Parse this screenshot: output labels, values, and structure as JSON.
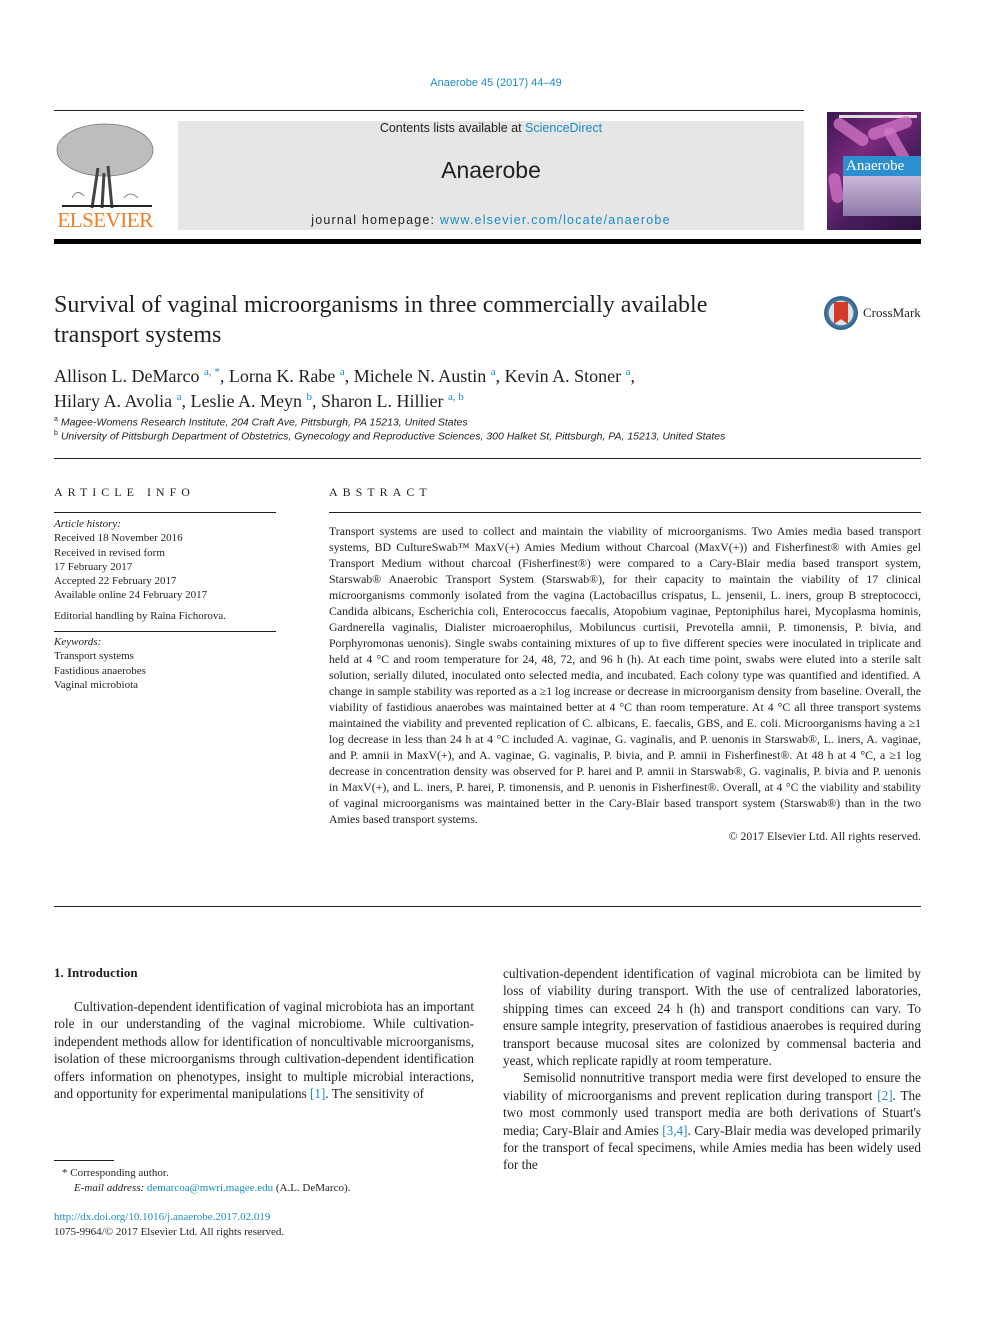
{
  "header": {
    "citation": "Anaerobe 45 (2017) 44–49",
    "contents_prefix": "Contents lists available at ",
    "contents_link": "ScienceDirect",
    "journal_name": "Anaerobe",
    "homepage_prefix": "journal homepage: ",
    "homepage_link": "www.elsevier.com/locate/anaerobe",
    "publisher_logo_text": "ELSEVIER",
    "cover_title": "Anaerobe",
    "crossmark_label": "CrossMark"
  },
  "article": {
    "title": "Survival of vaginal microorganisms in three commercially available transport systems",
    "authors": [
      {
        "name": "Allison L. DeMarco",
        "sup": "a, *"
      },
      {
        "name": "Lorna K. Rabe",
        "sup": "a"
      },
      {
        "name": "Michele N. Austin",
        "sup": "a"
      },
      {
        "name": "Kevin A. Stoner",
        "sup": "a"
      },
      {
        "name": "Hilary A. Avolia",
        "sup": "a"
      },
      {
        "name": "Leslie A. Meyn",
        "sup": "b"
      },
      {
        "name": "Sharon L. Hillier",
        "sup": "a, b"
      }
    ],
    "affiliations": [
      {
        "sup": "a",
        "text": "Magee-Womens Research Institute, 204 Craft Ave, Pittsburgh, PA 15213, United States"
      },
      {
        "sup": "b",
        "text": "University of Pittsburgh Department of Obstetrics, Gynecology and Reproductive Sciences, 300 Halket St, Pittsburgh, PA, 15213, United States"
      }
    ]
  },
  "article_info": {
    "heading": "ARTICLE INFO",
    "history_label": "Article history:",
    "history": [
      "Received 18 November 2016",
      "Received in revised form",
      "17 February 2017",
      "Accepted 22 February 2017",
      "Available online 24 February 2017"
    ],
    "editorial": "Editorial handling by Raina Fichorova.",
    "keywords_label": "Keywords:",
    "keywords": [
      "Transport systems",
      "Fastidious anaerobes",
      "Vaginal microbiota"
    ]
  },
  "abstract": {
    "heading": "ABSTRACT",
    "text": "Transport systems are used to collect and maintain the viability of microorganisms. Two Amies media based transport systems, BD CultureSwab™ MaxV(+) Amies Medium without Charcoal (MaxV(+)) and Fisherfinest® with Amies gel Transport Medium without charcoal (Fisherfinest®) were compared to a Cary-Blair media based transport system, Starswab® Anaerobic Transport System (Starswab®), for their capacity to maintain the viability of 17 clinical microorganisms commonly isolated from the vagina (Lactobacillus crispatus, L. jensenii, L. iners, group B streptococci, Candida albicans, Escherichia coli, Enterococcus faecalis, Atopobium vaginae, Peptoniphilus harei, Mycoplasma hominis, Gardnerella vaginalis, Dialister microaerophilus, Mobiluncus curtisii, Prevotella amnii, P. timonensis, P. bivia, and Porphyromonas uenonis). Single swabs containing mixtures of up to five different species were inoculated in triplicate and held at 4 °C and room temperature for 24, 48, 72, and 96 h (h). At each time point, swabs were eluted into a sterile salt solution, serially diluted, inoculated onto selected media, and incubated. Each colony type was quantified and identified. A change in sample stability was reported as a ≥1 log increase or decrease in microorganism density from baseline. Overall, the viability of fastidious anaerobes was maintained better at 4 °C than room temperature. At 4 °C all three transport systems maintained the viability and prevented replication of C. albicans, E. faecalis, GBS, and E. coli. Microorganisms having a ≥1 log decrease in less than 24 h at 4 °C included A. vaginae, G. vaginalis, and P. uenonis in Starswab®, L. iners, A. vaginae, and P. amnii in MaxV(+), and A. vaginae, G. vaginalis, P. bivia, and P. amnii in Fisherfinest®. At 48 h at 4 °C, a ≥1 log decrease in concentration density was observed for P. harei and P. amnii in Starswab®, G. vaginalis, P. bivia and P. uenonis in MaxV(+), and L. iners, P. harei, P. timonensis, and P. uenonis in Fisherfinest®. Overall, at 4 °C the viability and stability of vaginal microorganisms was maintained better in the Cary-Blair based transport system (Starswab®) than in the two Amies based transport systems.",
    "copyright": "© 2017 Elsevier Ltd. All rights reserved."
  },
  "body": {
    "section_heading": "1.  Introduction",
    "left_paragraph": "Cultivation-dependent identification of vaginal microbiota has an important role in our understanding of the vaginal microbiome. While cultivation-independent methods allow for identification of noncultivable microorganisms, isolation of these microorganisms through cultivation-dependent identification offers information on phenotypes, insight to multiple microbial interactions, and opportunity for experimental manipulations",
    "left_ref": "[1]",
    "left_tail": ". The sensitivity of",
    "right_paragraph_1": "cultivation-dependent identification of vaginal microbiota can be limited by loss of viability during transport. With the use of centralized laboratories, shipping times can exceed 24 h (h) and transport conditions can vary. To ensure sample integrity, preservation of fastidious anaerobes is required during transport because mucosal sites are colonized by commensal bacteria and yeast, which replicate rapidly at room temperature.",
    "right_paragraph_2a": "Semisolid nonnutritive transport media were first developed to ensure the viability of microorganisms and prevent replication during transport ",
    "right_ref_2": "[2]",
    "right_paragraph_2b": ". The two most commonly used transport media are both derivations of Stuart's media; Cary-Blair and Amies ",
    "right_ref_34": "[3,4]",
    "right_paragraph_2c": ". Cary-Blair media was developed primarily for the transport of fecal specimens, while Amies media has been widely used for the"
  },
  "footnotes": {
    "corresponding": "* Corresponding author.",
    "email_label": "E-mail address: ",
    "email": "demarcoa@mwri.magee.edu",
    "email_suffix": " (A.L. DeMarco).",
    "doi": "http://dx.doi.org/10.1016/j.anaerobe.2017.02.019",
    "issn": "1075-9964/© 2017 Elsevier Ltd. All rights reserved."
  }
}
